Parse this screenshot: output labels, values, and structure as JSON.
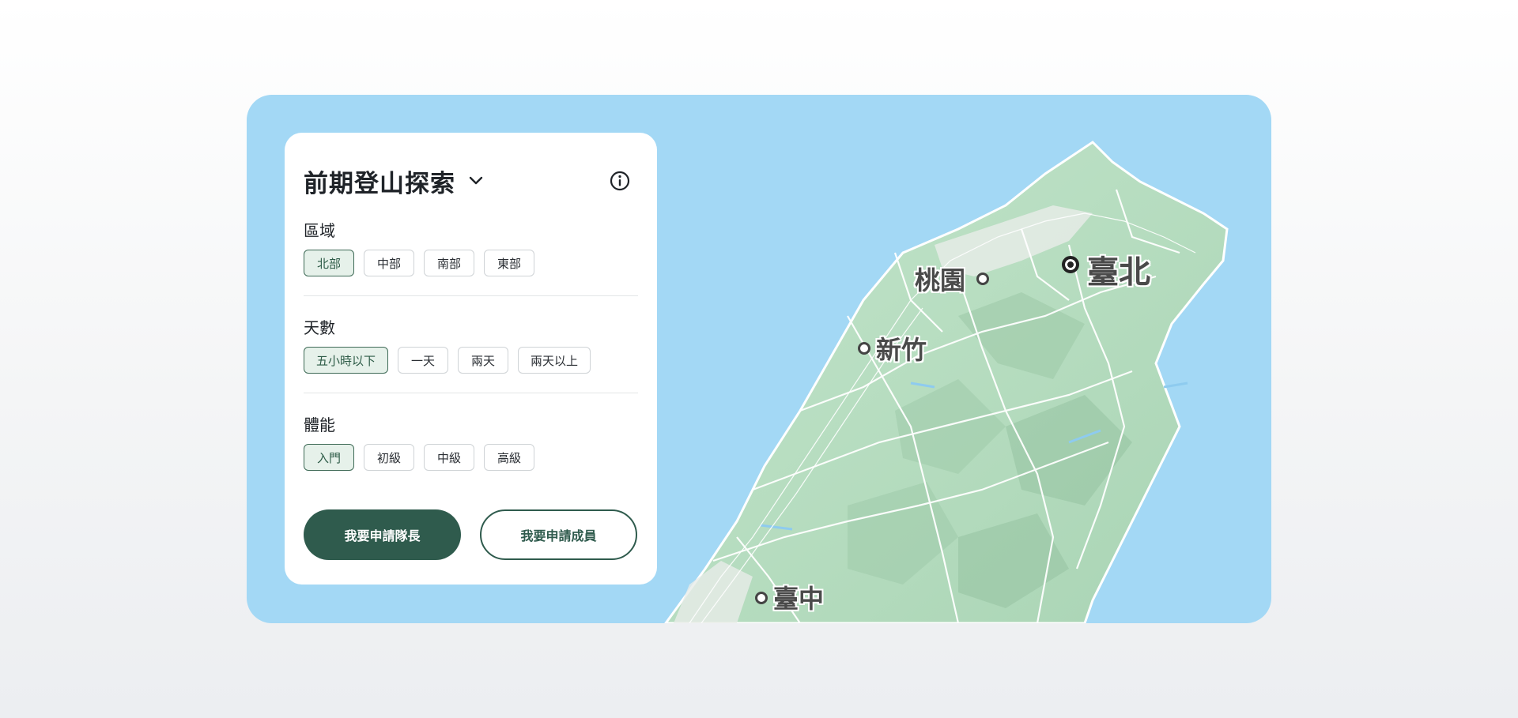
{
  "panel": {
    "title": "前期登山探索",
    "sections": [
      {
        "label": "區域",
        "options": [
          "北部",
          "中部",
          "南部",
          "東部"
        ],
        "selected": "北部"
      },
      {
        "label": "天數",
        "options": [
          "五小時以下",
          "一天",
          "兩天",
          "兩天以上"
        ],
        "selected": "五小時以下"
      },
      {
        "label": "體能",
        "options": [
          "入門",
          "初級",
          "中級",
          "高級"
        ],
        "selected": "入門"
      }
    ],
    "buttons": {
      "leader": "我要申請隊長",
      "member": "我要申請成員"
    }
  },
  "map": {
    "cities": {
      "taipei": "臺北",
      "taoyuan": "桃園",
      "hsinchu": "新竹",
      "taichung": "臺中"
    }
  },
  "colors": {
    "accent": "#2f5b4d",
    "ocean": "#a3d8f5",
    "land": "#b5dcc0",
    "selected_chip_bg": "#e6f1ea"
  }
}
